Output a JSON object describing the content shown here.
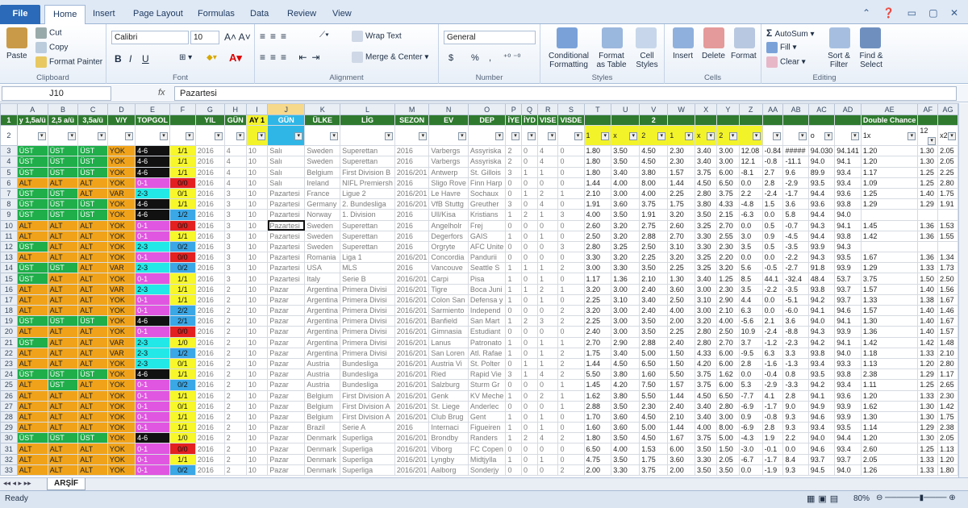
{
  "tabs": [
    "File",
    "Home",
    "Insert",
    "Page Layout",
    "Formulas",
    "Data",
    "Review",
    "View"
  ],
  "clipboard": {
    "paste": "Paste",
    "cut": "Cut",
    "copy": "Copy",
    "painter": "Format Painter",
    "label": "Clipboard"
  },
  "font": {
    "name": "Calibri",
    "size": "10",
    "label": "Font",
    "bold": "B",
    "italic": "I",
    "underline": "U"
  },
  "alignment": {
    "wrap": "Wrap Text",
    "merge": "Merge & Center",
    "label": "Alignment"
  },
  "number": {
    "format": "General",
    "label": "Number",
    "currency": "$",
    "percent": "%",
    "comma": ","
  },
  "styles": {
    "cond": "Conditional Formatting",
    "table": "Format as Table",
    "cell": "Cell Styles",
    "label": "Styles"
  },
  "cells": {
    "insert": "Insert",
    "delete": "Delete",
    "format": "Format",
    "label": "Cells"
  },
  "editing": {
    "autosum": "AutoSum",
    "fill": "Fill",
    "clear": "Clear",
    "sort": "Sort & Filter",
    "find": "Find & Select",
    "label": "Editing"
  },
  "formula_bar": {
    "name_box": "J10",
    "fx": "fx",
    "value": "Pazartesi"
  },
  "columns": [
    "A",
    "B",
    "C",
    "D",
    "E",
    "F",
    "G",
    "H",
    "I",
    "J",
    "K",
    "L",
    "M",
    "N",
    "O",
    "P",
    "Q",
    "R",
    "S",
    "T",
    "U",
    "V",
    "W",
    "X",
    "Y",
    "Z",
    "AA",
    "AB",
    "AC",
    "AD",
    "AE",
    "AF",
    "AG"
  ],
  "header_row": [
    "y 1,5a/ü",
    "2,5 a/ü",
    "3,5a/ü",
    "V/Y",
    "TOPGOL",
    "",
    "YIL",
    "GÜN",
    "AY 1",
    "GÜN",
    "ÜLKE",
    "LİG",
    "SEZON",
    "EV",
    "DEP",
    "İYE",
    "İYD",
    "VISE",
    "VISDE",
    "",
    "",
    "2",
    "",
    "",
    "",
    "",
    "",
    "",
    "",
    "",
    "Double Chance",
    "",
    ""
  ],
  "row2": [
    "",
    "",
    "",
    "",
    "",
    "",
    "",
    "",
    "",
    "",
    "",
    "",
    "",
    "",
    "",
    "",
    "",
    "",
    "",
    "1",
    "x",
    "2",
    "1",
    "x",
    "2",
    "",
    "",
    "",
    "o",
    "",
    "1x",
    "12",
    "x2"
  ],
  "rows": [
    [
      "ÜST",
      "ÜST",
      "ÜST",
      "YOK",
      "4-6",
      "1/1",
      "2016",
      "4",
      "10",
      "Salı",
      "Sweden",
      "Superettan",
      "2016",
      "Varbergs",
      "Assyriska",
      "2",
      "0",
      "4",
      "0",
      "1.80",
      "3.50",
      "4.50",
      "2.30",
      "3.40",
      "3.00",
      "12.08",
      "-0.84",
      "#####",
      "94.030",
      "94.141",
      "1.20",
      "1.30",
      "2.05"
    ],
    [
      "ÜST",
      "ÜST",
      "ÜST",
      "YOK",
      "4-6",
      "1/1",
      "2016",
      "4",
      "10",
      "Salı",
      "Sweden",
      "Superettan",
      "2016",
      "Varbergs",
      "Assyriska",
      "2",
      "0",
      "4",
      "0",
      "1.80",
      "3.50",
      "4.50",
      "2.30",
      "3.40",
      "3.00",
      "12.1",
      "-0.8",
      "-11.1",
      "94.0",
      "94.1",
      "1.20",
      "1.30",
      "2.05"
    ],
    [
      "ÜST",
      "ÜST",
      "ÜST",
      "YOK",
      "4-6",
      "1/1",
      "2016",
      "4",
      "10",
      "Salı",
      "Belgium",
      "First Division B",
      "2016/201",
      "Antwerp",
      "St. Gillois",
      "3",
      "1",
      "1",
      "0",
      "1.80",
      "3.40",
      "3.80",
      "1.57",
      "3.75",
      "6.00",
      "-8.1",
      "2.7",
      "9.6",
      "89.9",
      "93.4",
      "1.17",
      "1.25",
      "2.25"
    ],
    [
      "ALT",
      "ALT",
      "ALT",
      "YOK",
      "0-1",
      "0/0",
      "2016",
      "4",
      "10",
      "Salı",
      "Ireland",
      "NIFL Premiersh",
      "2016",
      "Sligo Rove",
      "Finn Harp",
      "0",
      "0",
      "0",
      "0",
      "1.44",
      "4.00",
      "8.00",
      "1.44",
      "4.50",
      "6.50",
      "0.0",
      "2.8",
      "-2.9",
      "93.5",
      "93.4",
      "1.09",
      "1.25",
      "2.80"
    ],
    [
      "ÜST",
      "ÜST",
      "ALT",
      "VAR",
      "2-3",
      "0/1",
      "2016",
      "3",
      "10",
      "Pazartesi",
      "France",
      "Ligue 2",
      "2016/201",
      "Le Havre",
      "Sochaux",
      "0",
      "1",
      "2",
      "1",
      "2.10",
      "3.00",
      "4.00",
      "2.25",
      "2.80",
      "3.75",
      "2.2",
      "-2.4",
      "-1.7",
      "94.4",
      "93.6",
      "1.25",
      "1.40",
      "1.75"
    ],
    [
      "ÜST",
      "ÜST",
      "ÜST",
      "YOK",
      "4-6",
      "1/1",
      "2016",
      "3",
      "10",
      "Pazartesi",
      "Germany",
      "2. Bundesliga",
      "2016/201",
      "VfB Stuttg",
      "Greuther",
      "3",
      "0",
      "4",
      "0",
      "1.91",
      "3.60",
      "3.75",
      "1.75",
      "3.80",
      "4.33",
      "-4.8",
      "1.5",
      "3.6",
      "93.6",
      "93.8",
      "1.29",
      "1.29",
      "1.91"
    ],
    [
      "ÜST",
      "ÜST",
      "ÜST",
      "YOK",
      "4-6",
      "1/2",
      "2016",
      "3",
      "10",
      "Pazartesi",
      "Norway",
      "1. Division",
      "2016",
      "Ull/Kisa",
      "Kristians",
      "1",
      "2",
      "1",
      "3",
      "4.00",
      "3.50",
      "1.91",
      "3.20",
      "3.50",
      "2.15",
      "-6.3",
      "0.0",
      "5.8",
      "94.4",
      "94.0",
      "",
      "",
      ""
    ],
    [
      "ALT",
      "ALT",
      "ALT",
      "YOK",
      "0-1",
      "0/0",
      "2016",
      "3",
      "10",
      "Pazartesi",
      "Sweden",
      "Superettan",
      "2016",
      "Angelholr",
      "Frej",
      "0",
      "0",
      "0",
      "0",
      "2.60",
      "3.20",
      "2.75",
      "2.60",
      "3.25",
      "2.70",
      "0.0",
      "0.5",
      "-0.7",
      "94.3",
      "94.1",
      "1.45",
      "1.36",
      "1.53"
    ],
    [
      "ALT",
      "ALT",
      "ALT",
      "YOK",
      "0-1",
      "1/1",
      "2016",
      "3",
      "10",
      "Pazartesi",
      "Sweden",
      "Superettan",
      "2016",
      "Degerfors",
      "GAIS",
      "1",
      "0",
      "1",
      "0",
      "2.50",
      "3.20",
      "2.88",
      "2.70",
      "3.30",
      "2.55",
      "3.0",
      "0.9",
      "-4.5",
      "94.4",
      "93.8",
      "1.42",
      "1.36",
      "1.55"
    ],
    [
      "ÜST",
      "ALT",
      "ALT",
      "YOK",
      "2-3",
      "0/2",
      "2016",
      "3",
      "10",
      "Pazartesi",
      "Sweden",
      "Superettan",
      "2016",
      "Orgryte",
      "AFC Unite",
      "0",
      "0",
      "0",
      "3",
      "2.80",
      "3.25",
      "2.50",
      "3.10",
      "3.30",
      "2.30",
      "3.5",
      "0.5",
      "-3.5",
      "93.9",
      "94.3",
      "",
      "",
      ""
    ],
    [
      "ALT",
      "ALT",
      "ALT",
      "YOK",
      "0-1",
      "0/0",
      "2016",
      "3",
      "10",
      "Pazartesi",
      "Romania",
      "Liga 1",
      "2016/201",
      "Concordia",
      "Pandurii",
      "0",
      "0",
      "0",
      "0",
      "3.30",
      "3.20",
      "2.25",
      "3.20",
      "3.25",
      "2.20",
      "0.0",
      "0.0",
      "-2.2",
      "94.3",
      "93.5",
      "1.67",
      "1.36",
      "1.34"
    ],
    [
      "ÜST",
      "ÜST",
      "ALT",
      "VAR",
      "2-3",
      "0/2",
      "2016",
      "3",
      "10",
      "Pazartesi",
      "USA",
      "MLS",
      "2016",
      "Vancouve",
      "Seattle S",
      "1",
      "1",
      "1",
      "2",
      "3.00",
      "3.30",
      "3.50",
      "2.25",
      "3.25",
      "3.20",
      "5.6",
      "-0.5",
      "-2.7",
      "91.8",
      "93.9",
      "1.29",
      "1.33",
      "1.73"
    ],
    [
      "ÜST",
      "ALT",
      "ALT",
      "YOK",
      "0-1",
      "1/1",
      "2016",
      "3",
      "10",
      "Pazartesi",
      "Italy",
      "Serie B",
      "2016/201",
      "Carpi",
      "Pisa",
      "1",
      "0",
      "1",
      "0",
      "1.17",
      "1.36",
      "2.10",
      "1.30",
      "3.40",
      "1.25",
      "8.5",
      "44.1",
      "-32.4",
      "48.4",
      "53.7",
      "3.75",
      "1.50",
      "2.50"
    ],
    [
      "ALT",
      "ALT",
      "ALT",
      "VAR",
      "2-3",
      "1/1",
      "2016",
      "2",
      "10",
      "Pazar",
      "Argentina",
      "Primera Divisi",
      "2016/201",
      "Tigre",
      "Boca Juni",
      "1",
      "1",
      "2",
      "1",
      "3.20",
      "3.00",
      "2.40",
      "3.60",
      "3.00",
      "2.30",
      "3.5",
      "-2.2",
      "-3.5",
      "93.8",
      "93.7",
      "1.57",
      "1.40",
      "1.56"
    ],
    [
      "ALT",
      "ALT",
      "ALT",
      "YOK",
      "0-1",
      "1/1",
      "2016",
      "2",
      "10",
      "Pazar",
      "Argentina",
      "Primera Divisi",
      "2016/201",
      "Colon San",
      "Defensa y",
      "1",
      "0",
      "1",
      "0",
      "2.25",
      "3.10",
      "3.40",
      "2.50",
      "3.10",
      "2.90",
      "4.4",
      "0.0",
      "-5.1",
      "94.2",
      "93.7",
      "1.33",
      "1.38",
      "1.67"
    ],
    [
      "ALT",
      "ALT",
      "ALT",
      "YOK",
      "0-1",
      "2/2",
      "2016",
      "2",
      "10",
      "Pazar",
      "Argentina",
      "Primera Divisi",
      "2016/201",
      "Sarmiento",
      "Independ",
      "0",
      "0",
      "0",
      "2",
      "3.20",
      "3.00",
      "2.40",
      "4.00",
      "3.00",
      "2.10",
      "6.3",
      "0.0",
      "-6.0",
      "94.1",
      "94.6",
      "1.57",
      "1.40",
      "1.46"
    ],
    [
      "ÜST",
      "ÜST",
      "ÜST",
      "YOK",
      "4-6",
      "2/1",
      "2016",
      "2",
      "10",
      "Pazar",
      "Argentina",
      "Primera Divisi",
      "2016/201",
      "Banfield",
      "San Mart",
      "1",
      "2",
      "3",
      "2",
      "2.25",
      "3.00",
      "3.50",
      "2.00",
      "3.20",
      "4.00",
      "-5.6",
      "2.1",
      "3.6",
      "94.0",
      "94.1",
      "1.30",
      "1.40",
      "1.67"
    ],
    [
      "ALT",
      "ALT",
      "ALT",
      "YOK",
      "0-1",
      "0/0",
      "2016",
      "2",
      "10",
      "Pazar",
      "Argentina",
      "Primera Divisi",
      "2016/201",
      "Gimnasia",
      "Estudiant",
      "0",
      "0",
      "0",
      "0",
      "2.40",
      "3.00",
      "3.50",
      "2.25",
      "2.80",
      "2.50",
      "10.9",
      "-2.4",
      "-8.8",
      "94.3",
      "93.9",
      "1.36",
      "1.40",
      "1.57"
    ],
    [
      "ÜST",
      "ALT",
      "ALT",
      "VAR",
      "2-3",
      "1/0",
      "2016",
      "2",
      "10",
      "Pazar",
      "Argentina",
      "Primera Divisi",
      "2016/201",
      "Lanus",
      "Patronato",
      "1",
      "0",
      "1",
      "1",
      "2.70",
      "2.90",
      "2.88",
      "2.40",
      "2.80",
      "2.70",
      "3.7",
      "-1.2",
      "-2.3",
      "94.2",
      "94.1",
      "1.42",
      "1.42",
      "1.48"
    ],
    [
      "ALT",
      "ALT",
      "ALT",
      "VAR",
      "2-3",
      "1/2",
      "2016",
      "2",
      "10",
      "Pazar",
      "Argentina",
      "Primera Divisi",
      "2016/201",
      "San Loren",
      "Atl. Rafae",
      "1",
      "0",
      "1",
      "2",
      "1.75",
      "3.40",
      "5.00",
      "1.50",
      "4.33",
      "6.00",
      "-9.5",
      "6.3",
      "3.3",
      "93.8",
      "94.0",
      "1.18",
      "1.33",
      "2.10"
    ],
    [
      "ALT",
      "ALT",
      "ALT",
      "YOK",
      "2-3",
      "0/1",
      "2016",
      "2",
      "10",
      "Pazar",
      "Austria",
      "Bundesliga",
      "2016/201",
      "Austria Vi",
      "St. Polter",
      "0",
      "1",
      "1",
      "2",
      "1.44",
      "4.50",
      "6.50",
      "1.50",
      "4.20",
      "6.00",
      "2.8",
      "-1.6",
      "-1.3",
      "93.4",
      "93.3",
      "1.13",
      "1.20",
      "2.80"
    ],
    [
      "ÜST",
      "ÜST",
      "ÜST",
      "YOK",
      "4-6",
      "1/1",
      "2016",
      "2",
      "10",
      "Pazar",
      "Austria",
      "Bundesliga",
      "2016/201",
      "Ried",
      "Rapid Vie",
      "3",
      "1",
      "4",
      "2",
      "5.50",
      "3.80",
      "1.60",
      "5.50",
      "3.75",
      "1.62",
      "0.0",
      "-0.4",
      "0.8",
      "93.5",
      "93.8",
      "2.38",
      "1.29",
      "1.17"
    ],
    [
      "ALT",
      "ÜST",
      "ALT",
      "YOK",
      "0-1",
      "0/2",
      "2016",
      "2",
      "10",
      "Pazar",
      "Austria",
      "Bundesliga",
      "2016/201",
      "Salzburg",
      "Sturm Gr",
      "0",
      "0",
      "0",
      "1",
      "1.45",
      "4.20",
      "7.50",
      "1.57",
      "3.75",
      "6.00",
      "5.3",
      "-2.9",
      "-3.3",
      "94.2",
      "93.4",
      "1.11",
      "1.25",
      "2.65"
    ],
    [
      "ALT",
      "ALT",
      "ALT",
      "YOK",
      "0-1",
      "1/1",
      "2016",
      "2",
      "10",
      "Pazar",
      "Belgium",
      "First Division A",
      "2016/201",
      "Genk",
      "KV Meche",
      "1",
      "0",
      "2",
      "1",
      "1.62",
      "3.80",
      "5.50",
      "1.44",
      "4.50",
      "6.50",
      "-7.7",
      "4.1",
      "2.8",
      "94.1",
      "93.6",
      "1.20",
      "1.33",
      "2.30"
    ],
    [
      "ALT",
      "ALT",
      "ALT",
      "YOK",
      "0-1",
      "0/1",
      "2016",
      "2",
      "10",
      "Pazar",
      "Belgium",
      "First Division A",
      "2016/201",
      "St. Liege",
      "Anderlec",
      "0",
      "0",
      "0",
      "1",
      "2.88",
      "3.50",
      "2.30",
      "2.40",
      "3.40",
      "2.80",
      "-6.9",
      "-1.7",
      "9.0",
      "94.9",
      "93.9",
      "1.62",
      "1.30",
      "1.42"
    ],
    [
      "ALT",
      "ALT",
      "ALT",
      "YOK",
      "0-1",
      "1/1",
      "2016",
      "2",
      "10",
      "Pazar",
      "Belgium",
      "First Division A",
      "2016/201",
      "Club Brug",
      "Gent",
      "1",
      "0",
      "1",
      "0",
      "1.70",
      "3.60",
      "4.50",
      "2.10",
      "3.40",
      "3.00",
      "0.9",
      "-0.8",
      "9.3",
      "94.6",
      "93.9",
      "1.30",
      "1.30",
      "1.75"
    ],
    [
      "ALT",
      "ALT",
      "ALT",
      "YOK",
      "0-1",
      "1/1",
      "2016",
      "2",
      "10",
      "Pazar",
      "Brazil",
      "Serie A",
      "2016",
      "Internaci",
      "Figueiren",
      "1",
      "0",
      "1",
      "0",
      "1.60",
      "3.60",
      "5.00",
      "1.44",
      "4.00",
      "8.00",
      "-6.9",
      "2.8",
      "9.3",
      "93.4",
      "93.5",
      "1.14",
      "1.29",
      "2.38"
    ],
    [
      "ÜST",
      "ÜST",
      "ÜST",
      "YOK",
      "4-6",
      "1/0",
      "2016",
      "2",
      "10",
      "Pazar",
      "Denmark",
      "Superliga",
      "2016/201",
      "Brondby",
      "Randers",
      "1",
      "2",
      "4",
      "2",
      "1.80",
      "3.50",
      "4.50",
      "1.67",
      "3.75",
      "5.00",
      "-4.3",
      "1.9",
      "2.2",
      "94.0",
      "94.4",
      "1.20",
      "1.30",
      "2.05"
    ],
    [
      "ALT",
      "ALT",
      "ALT",
      "YOK",
      "0-1",
      "0/0",
      "2016",
      "2",
      "10",
      "Pazar",
      "Denmark",
      "Superliga",
      "2016/201",
      "Viborg",
      "FC Copen",
      "0",
      "0",
      "0",
      "0",
      "6.50",
      "4.00",
      "1.53",
      "6.00",
      "3.50",
      "1.50",
      "-3.0",
      "-0.1",
      "0.0",
      "94.6",
      "93.4",
      "2.60",
      "1.25",
      "1.13"
    ],
    [
      "ALT",
      "ALT",
      "ALT",
      "YOK",
      "0-1",
      "1/1",
      "2016",
      "2",
      "10",
      "Pazar",
      "Denmark",
      "Superliga",
      "2016/201",
      "Lyngby",
      "Midtjylla",
      "1",
      "0",
      "1",
      "0",
      "4.75",
      "3.50",
      "1.75",
      "3.60",
      "3.30",
      "2.05",
      "-6.7",
      "-1.7",
      "8.4",
      "93.7",
      "93.7",
      "2.05",
      "1.33",
      "1.20"
    ],
    [
      "ALT",
      "ALT",
      "ALT",
      "YOK",
      "0-1",
      "0/2",
      "2016",
      "2",
      "10",
      "Pazar",
      "Denmark",
      "Superliga",
      "2016/201",
      "Aalborg",
      "Sonderjy",
      "0",
      "0",
      "0",
      "2",
      "2.00",
      "3.30",
      "3.75",
      "2.00",
      "3.50",
      "3.50",
      "0.0",
      "-1.9",
      "9.3",
      "94.5",
      "94.0",
      "1.26",
      "1.33",
      "1.80"
    ]
  ],
  "sheet_tab": "ARŞİF",
  "status": {
    "ready": "Ready",
    "zoom": "80%"
  },
  "colors": {
    "green": "#1fae4a",
    "orange": "#f0a31a",
    "black": "#111111",
    "cyan": "#22e8e8",
    "magenta": "#e056e0",
    "yellow": "#f7f72a",
    "red": "#e42020",
    "blue": "#3aa7e6"
  }
}
